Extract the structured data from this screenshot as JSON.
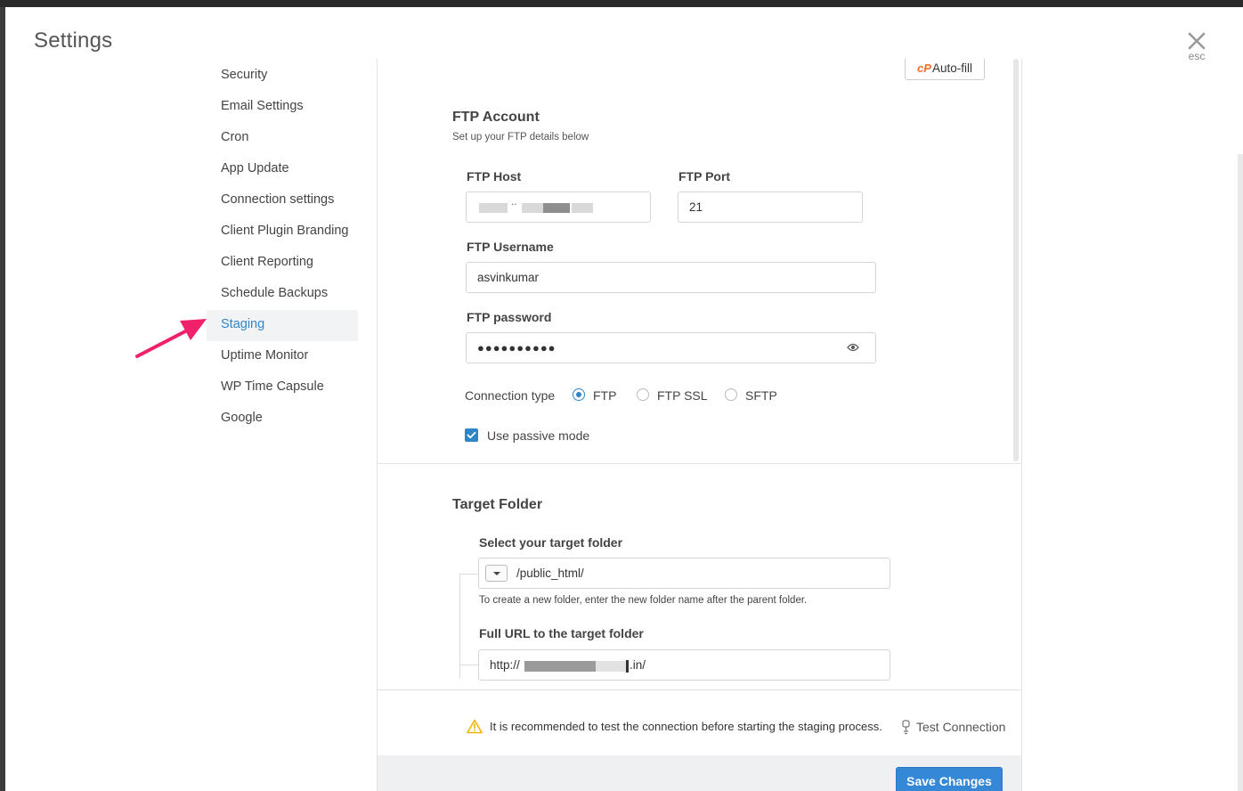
{
  "modal": {
    "title": "Settings",
    "close_hint": "esc"
  },
  "sidebar": {
    "items": [
      {
        "label": "Security"
      },
      {
        "label": "Email Settings"
      },
      {
        "label": "Cron"
      },
      {
        "label": "App Update"
      },
      {
        "label": "Connection settings"
      },
      {
        "label": "Client Plugin Branding"
      },
      {
        "label": "Client Reporting"
      },
      {
        "label": "Schedule Backups"
      },
      {
        "label": "Staging",
        "active": true
      },
      {
        "label": "Uptime Monitor"
      },
      {
        "label": "WP Time Capsule"
      },
      {
        "label": "Google"
      }
    ]
  },
  "autofill": {
    "logo": "cP",
    "label": "Auto-fill"
  },
  "ftp": {
    "title": "FTP Account",
    "subtitle": "Set up your FTP details below",
    "host_label": "FTP Host",
    "host_value": "..",
    "port_label": "FTP Port",
    "port_value": "21",
    "username_label": "FTP Username",
    "username_value": "asvinkumar",
    "password_label": "FTP password",
    "password_value": "●●●●●●●●●●",
    "connection_type_label": "Connection type",
    "connection_types": [
      "FTP",
      "FTP SSL",
      "SFTP"
    ],
    "selected_connection_type": "FTP",
    "passive_mode_label": "Use passive mode",
    "passive_mode_checked": true
  },
  "target": {
    "title": "Target Folder",
    "folder_label": "Select your target folder",
    "folder_value": "/public_html/",
    "folder_hint": "To create a new folder, enter the new folder name after the parent folder.",
    "url_label": "Full URL to the target folder",
    "url_prefix": "http://",
    "url_suffix": ".in/"
  },
  "warning": {
    "text": "It is recommended to test the connection before starting the staging process."
  },
  "test_connection": {
    "label": "Test Connection"
  },
  "save": {
    "label": "Save Changes"
  },
  "colors": {
    "accent": "#3488d6",
    "active_text": "#2f86c7",
    "arrow": "#f0206a",
    "warning": "#f0b400",
    "cpanel": "#ff6c2c"
  }
}
